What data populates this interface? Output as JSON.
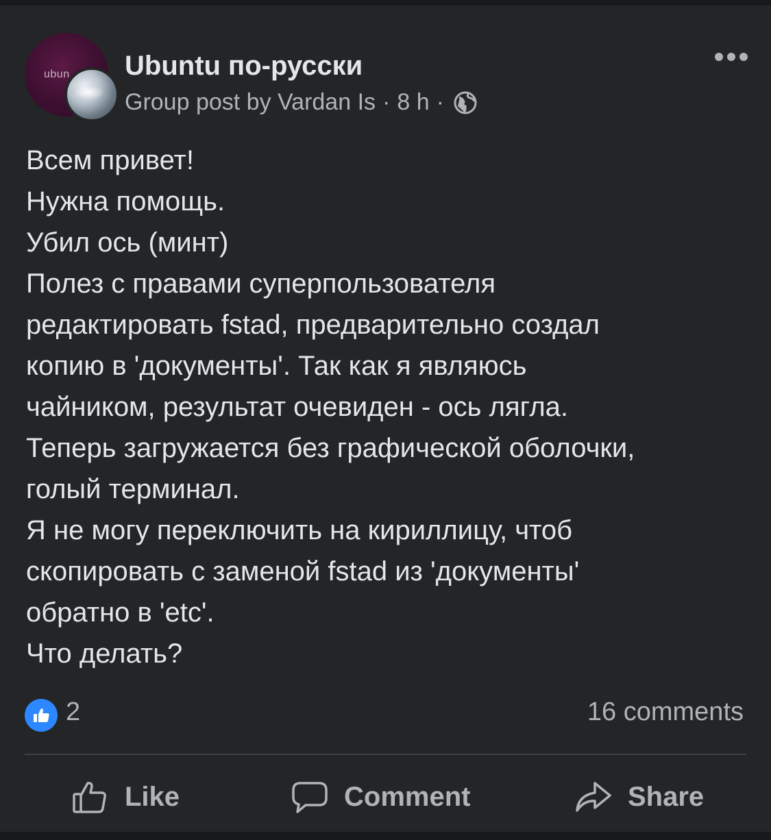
{
  "post": {
    "group_name": "Ubuntu по-русски",
    "avatar_text": "ubun",
    "meta": {
      "prefix": "Group post by",
      "author": "Vardan Is",
      "separator": "·",
      "time": "8 h",
      "privacy_icon": "globe-icon"
    },
    "more_icon": "more-options-icon",
    "lines": [
      "Всем привет!",
      "Нужна помощь.",
      "Убил ось (минт)",
      "Полез с правами суперпользователя",
      "редактировать fstad, предварительно создал",
      "копию в 'документы'. Так как я являюсь",
      "чайником, результат очевиден - ось лягла.",
      "Теперь загружается без графической оболочки,",
      "голый терминал.",
      "Я не могу переключить на кириллицу, чтоб",
      "скопировать с заменой fstad из 'документы'",
      "обратно в 'etc'.",
      "Что делать?"
    ]
  },
  "reactions": {
    "icon": "like-reaction-icon",
    "count": "2",
    "comments": "16 comments",
    "accent": "#2d88ff"
  },
  "actions": {
    "like_label": "Like",
    "comment_label": "Comment",
    "share_label": "Share"
  }
}
